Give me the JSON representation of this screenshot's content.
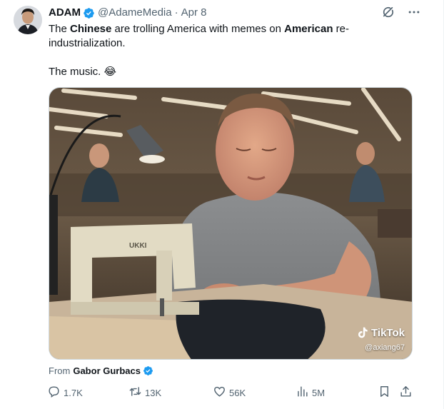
{
  "author": {
    "display_name": "ADAM",
    "handle": "@AdameMedia",
    "separator": "·",
    "date": "Apr 8"
  },
  "tweet": {
    "line1_pre": "The ",
    "line1_b1": "Chinese",
    "line1_mid": " are trolling America with memes on ",
    "line1_b2": "American",
    "line1_post": " re-industrialization.",
    "line2": "The music. 😂"
  },
  "media": {
    "watermark_brand": "TikTok",
    "watermark_user": "@axiang67",
    "machine_brand": "UKKI"
  },
  "source": {
    "prefix": "From",
    "name": "Gabor Gurbacs"
  },
  "stats": {
    "replies": "1.7K",
    "reposts": "13K",
    "likes": "56K",
    "views": "5M"
  },
  "colors": {
    "accent": "#1d9bf0",
    "muted": "#536471"
  },
  "icons": [
    "verified-badge-icon",
    "grok-icon",
    "more-icon",
    "reply-icon",
    "repost-icon",
    "like-icon",
    "views-icon",
    "bookmark-icon",
    "share-icon",
    "tiktok-logo-icon"
  ]
}
